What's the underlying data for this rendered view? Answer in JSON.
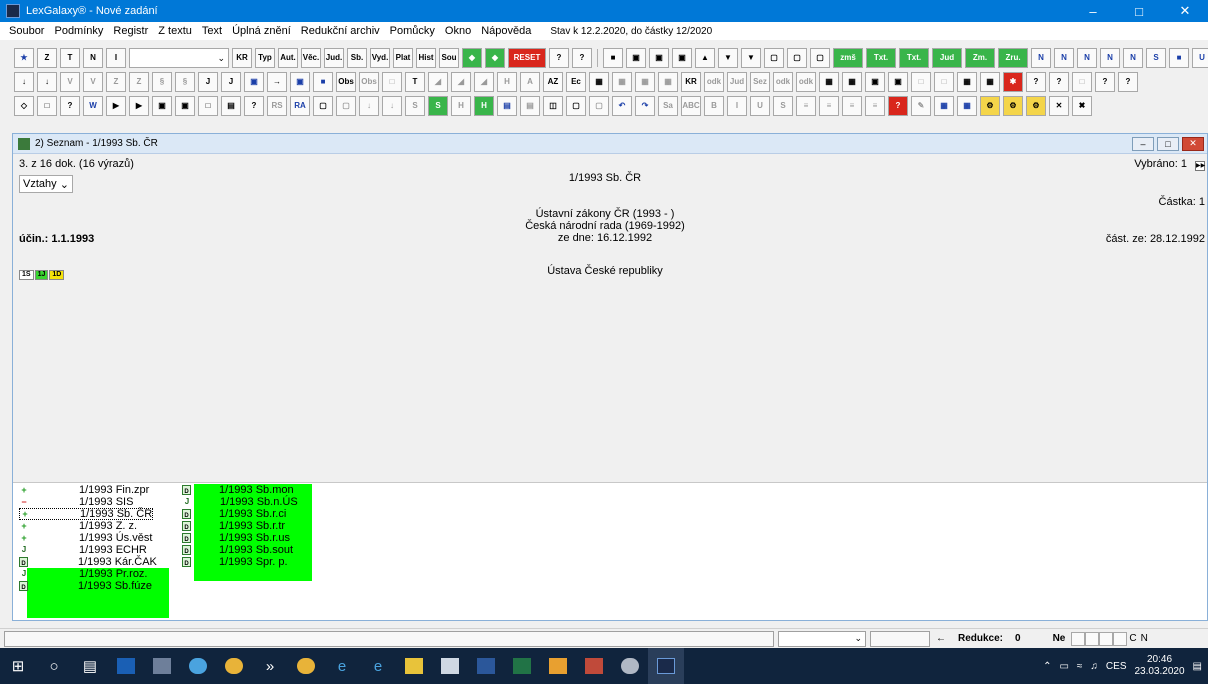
{
  "window": {
    "title": "LexGalaxy® - Nové zadání",
    "minimize": "–",
    "maximize": "□",
    "close": "✕"
  },
  "menu": {
    "items": [
      "Soubor",
      "Podmínky",
      "Registr",
      "Z textu",
      "Text",
      "Úplná znění",
      "Redukční archiv",
      "Pomůcky",
      "Okno",
      "Nápověda"
    ],
    "status": "Stav k 12.2.2020, do částky 12/2020"
  },
  "toolbar1": {
    "buttons": [
      "Typ",
      "Aut.",
      "Věc.",
      "Jud.",
      "Sb.",
      "Vyd.",
      "Plat",
      "Hist",
      "Sou",
      "RESET",
      "zmš",
      "Txt.",
      "Txt.",
      "Jud",
      "Zm.",
      "Zru."
    ],
    "combo_value": ""
  },
  "document": {
    "counter": "3. z 16 dok. (16 výrazů)",
    "vztahy": "Vztahy",
    "vybrano": "Vybráno: 1",
    "doc_title": "1/1993 Sb. ČR",
    "castka": "Částka: 1",
    "line1": "Ústavní zákony ČR (1993 -    )",
    "line2": "Česká národní rada (1969-1992)",
    "line3": "ze dne: 16.12.1992",
    "ucin": "účin.: 1.1.1993",
    "cast_ze": "část. ze: 28.12.1992",
    "badges": [
      "1S",
      "1J",
      "1D"
    ],
    "name": "Ústava České republiky"
  },
  "mdi": {
    "title": "2) Seznam - 1/1993 Sb. ČR"
  },
  "list_left": [
    {
      "marker": "+",
      "label": "1/1993 Fin.zpr"
    },
    {
      "marker": "−",
      "label": "1/1993 SIS"
    },
    {
      "marker": "+",
      "label": "1/1993 Sb. ČR"
    },
    {
      "marker": "+",
      "label": "1/1993 Z. z."
    },
    {
      "marker": "+",
      "label": "1/1993 Ús.věst"
    },
    {
      "marker": "J",
      "label": "1/1993 ECHR"
    },
    {
      "marker": "D",
      "label": "1/1993 Kár.ČAK"
    },
    {
      "marker": "J",
      "label": "1/1993 Pr.roz."
    },
    {
      "marker": "D",
      "label": "1/1993 Sb.fúze"
    }
  ],
  "list_right": [
    {
      "marker": "D",
      "label": "1/1993 Sb.mon"
    },
    {
      "marker": "J",
      "label": "1/1993 Sb.n.ÚS"
    },
    {
      "marker": "D",
      "label": "1/1993 Sb.r.ci"
    },
    {
      "marker": "D",
      "label": "1/1993 Sb.r.tr"
    },
    {
      "marker": "D",
      "label": "1/1993 Sb.r.us"
    },
    {
      "marker": "D",
      "label": "1/1993 Sb.sout"
    },
    {
      "marker": "D",
      "label": "1/1993 Spr. p."
    }
  ],
  "statusbar": {
    "redukce_label": "Redukce:",
    "redukce_value": "0",
    "ne": "Ne",
    "c": "C",
    "n": "N"
  },
  "taskbar": {
    "lang": "CES",
    "time": "20:46",
    "date": "23.03.2020"
  },
  "colors": {
    "titlebar": "#0078d7",
    "list_highlight": "#00ff00",
    "taskbar": "#10243d"
  }
}
